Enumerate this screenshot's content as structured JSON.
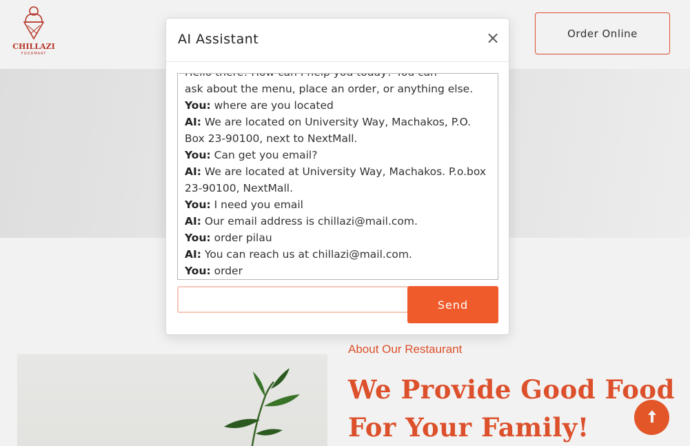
{
  "header": {
    "logo_text": "CHILLAZI",
    "logo_subtext": "FOODMART",
    "order_button": "Order Online"
  },
  "about": {
    "kicker": "About Our Restaurant",
    "title": "We Provide Good Food For Your Family!"
  },
  "modal": {
    "title": "AI Assistant",
    "close_symbol": "×",
    "messages": [
      {
        "speaker": "",
        "text": "Hello there! How can I help you today? You can"
      },
      {
        "speaker": "",
        "text": "ask about the menu, place an order, or anything else."
      },
      {
        "speaker": "You:",
        "text": "where are you located"
      },
      {
        "speaker": "AI:",
        "text": "We are located on University Way, Machakos, P.O. Box 23-90100, next to NextMall."
      },
      {
        "speaker": "You:",
        "text": "Can get you email?"
      },
      {
        "speaker": "AI:",
        "text": "We are located at University Way, Machakos. P.o.box 23-90100, NextMall."
      },
      {
        "speaker": "You:",
        "text": "I need you email"
      },
      {
        "speaker": "AI:",
        "text": "Our email address is chillazi@mail.com."
      },
      {
        "speaker": "You:",
        "text": "order pilau"
      },
      {
        "speaker": "AI:",
        "text": "You can reach us at chillazi@mail.com."
      },
      {
        "speaker": "You:",
        "text": "order"
      }
    ],
    "input_value": "",
    "send_label": "Send"
  },
  "icons": {
    "scroll_top": "arrow-up-icon",
    "close": "close-icon"
  },
  "colors": {
    "accent": "#ef5b2b",
    "accent_text": "#e8552e"
  }
}
